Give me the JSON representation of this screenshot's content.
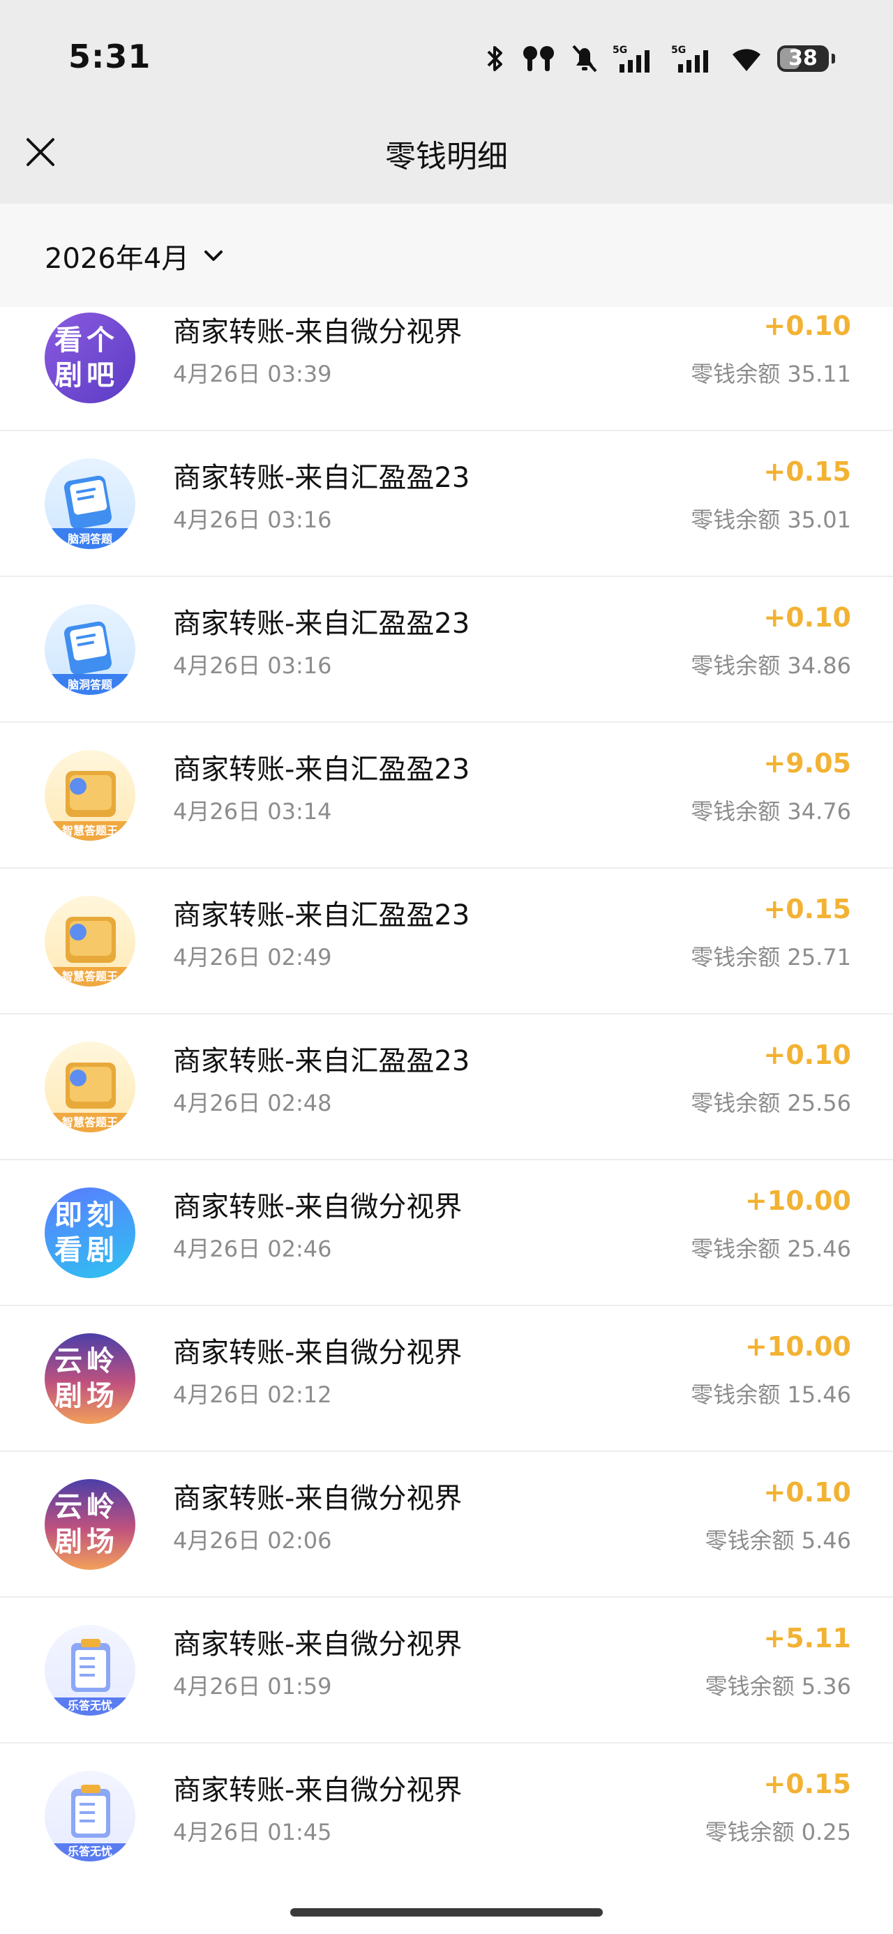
{
  "status_bar": {
    "time": "5:31",
    "battery": "38",
    "icons": [
      "bluetooth-icon",
      "earbuds-icon",
      "bell-muted-icon",
      "signal-5g-icon",
      "signal-5g-icon",
      "wifi-icon",
      "battery-icon"
    ]
  },
  "nav": {
    "title": "零钱明细",
    "close_icon": "close-icon"
  },
  "filter": {
    "month": "2026年4月",
    "dropdown_icon": "chevron-down-icon"
  },
  "colors": {
    "amount": "#f2b233",
    "secondary_text": "#8c8c8c",
    "header_bg": "#ececec"
  },
  "transactions": [
    {
      "avatar_text": "看个剧吧",
      "avatar_style": "purple",
      "title": "商家转账-来自微分视界",
      "datetime": "4月26日 03:39",
      "amount": "+0.10",
      "balance": "零钱余额 35.11"
    },
    {
      "avatar_text": "",
      "avatar_style": "blue-book",
      "avatar_caption": "脑洞答题",
      "title": "商家转账-来自汇盈盈23",
      "datetime": "4月26日 03:16",
      "amount": "+0.15",
      "balance": "零钱余额 35.01"
    },
    {
      "avatar_text": "",
      "avatar_style": "blue-book",
      "avatar_caption": "脑洞答题",
      "title": "商家转账-来自汇盈盈23",
      "datetime": "4月26日 03:16",
      "amount": "+0.10",
      "balance": "零钱余额 34.86"
    },
    {
      "avatar_text": "",
      "avatar_style": "gold-box",
      "avatar_caption": "智慧答题王",
      "title": "商家转账-来自汇盈盈23",
      "datetime": "4月26日 03:14",
      "amount": "+9.05",
      "balance": "零钱余额 34.76"
    },
    {
      "avatar_text": "",
      "avatar_style": "gold-box",
      "avatar_caption": "智慧答题王",
      "title": "商家转账-来自汇盈盈23",
      "datetime": "4月26日 02:49",
      "amount": "+0.15",
      "balance": "零钱余额 25.71"
    },
    {
      "avatar_text": "",
      "avatar_style": "gold-box",
      "avatar_caption": "智慧答题王",
      "title": "商家转账-来自汇盈盈23",
      "datetime": "4月26日 02:48",
      "amount": "+0.10",
      "balance": "零钱余额 25.56"
    },
    {
      "avatar_text": "即刻看剧",
      "avatar_style": "blue",
      "title": "商家转账-来自微分视界",
      "datetime": "4月26日 02:46",
      "amount": "+10.00",
      "balance": "零钱余额 25.46"
    },
    {
      "avatar_text": "云岭剧场",
      "avatar_style": "sunset",
      "title": "商家转账-来自微分视界",
      "datetime": "4月26日 02:12",
      "amount": "+10.00",
      "balance": "零钱余额 15.46"
    },
    {
      "avatar_text": "云岭剧场",
      "avatar_style": "sunset",
      "title": "商家转账-来自微分视界",
      "datetime": "4月26日 02:06",
      "amount": "+0.10",
      "balance": "零钱余额 5.46"
    },
    {
      "avatar_text": "",
      "avatar_style": "clipboard",
      "avatar_caption": "乐答无忧",
      "title": "商家转账-来自微分视界",
      "datetime": "4月26日 01:59",
      "amount": "+5.11",
      "balance": "零钱余额 5.36"
    },
    {
      "avatar_text": "",
      "avatar_style": "clipboard",
      "avatar_caption": "乐答无忧",
      "title": "商家转账-来自微分视界",
      "datetime": "4月26日 01:45",
      "amount": "+0.15",
      "balance": "零钱余额 0.25"
    }
  ]
}
